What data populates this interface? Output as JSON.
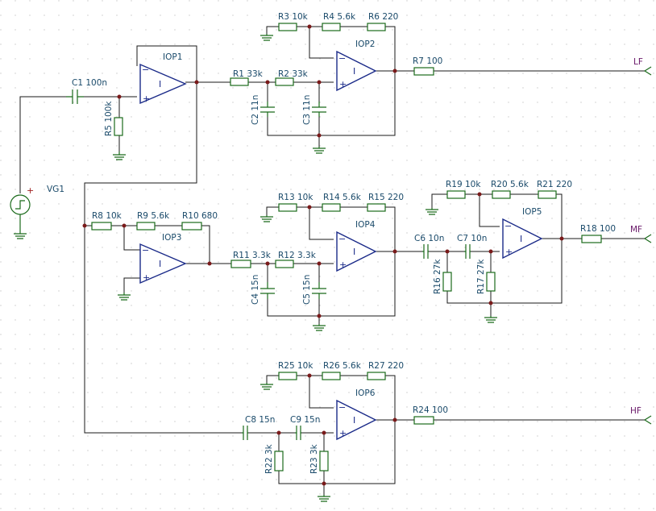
{
  "source": {
    "name": "VG1"
  },
  "opamps": [
    "IOP1",
    "IOP2",
    "IOP3",
    "IOP4",
    "IOP5",
    "IOP6"
  ],
  "components": {
    "C1": "C1 100n",
    "R5": "R5 100k",
    "R1": "R1 33k",
    "R2": "R2 33k",
    "C2": "C2 11n",
    "C3": "C3 11n",
    "R3": "R3 10k",
    "R4": "R4 5.6k",
    "R6": "R6 220",
    "R7": "R7 100",
    "R8": "R8 10k",
    "R9": "R9 5.6k",
    "R10": "R10 680",
    "R11": "R11 3.3k",
    "R12": "R12 3.3k",
    "C4": "C4 15n",
    "C5": "C5 15n",
    "R13": "R13 10k",
    "R14": "R14 5.6k",
    "R15": "R15 220",
    "C6": "C6 10n",
    "C7": "C7 10n",
    "R16": "R16 27k",
    "R17": "R17 27k",
    "R19": "R19 10k",
    "R20": "R20 5.6k",
    "R21": "R21 220",
    "R18": "R18 100",
    "R25": "R25 10k",
    "R26": "R26 5.6k",
    "R27": "R27 220",
    "C8": "C8 15n",
    "C9": "C9 15n",
    "R22": "R22 3k",
    "R23": "R23 3k",
    "R24": "R24 100"
  },
  "outputs": {
    "lf": "LF",
    "mf": "MF",
    "hf": "HF"
  },
  "symbols": {
    "minus": "−",
    "plus": "+",
    "gain": "I"
  },
  "colors": {
    "background": "#ffffff",
    "grid_dot": "#c8c8c8",
    "wire": "#1a1a1a",
    "component": "#1a6a1a",
    "opamp": "#1a2a88",
    "label": "#1a4a6a",
    "net_label": "#6a1a6a"
  }
}
